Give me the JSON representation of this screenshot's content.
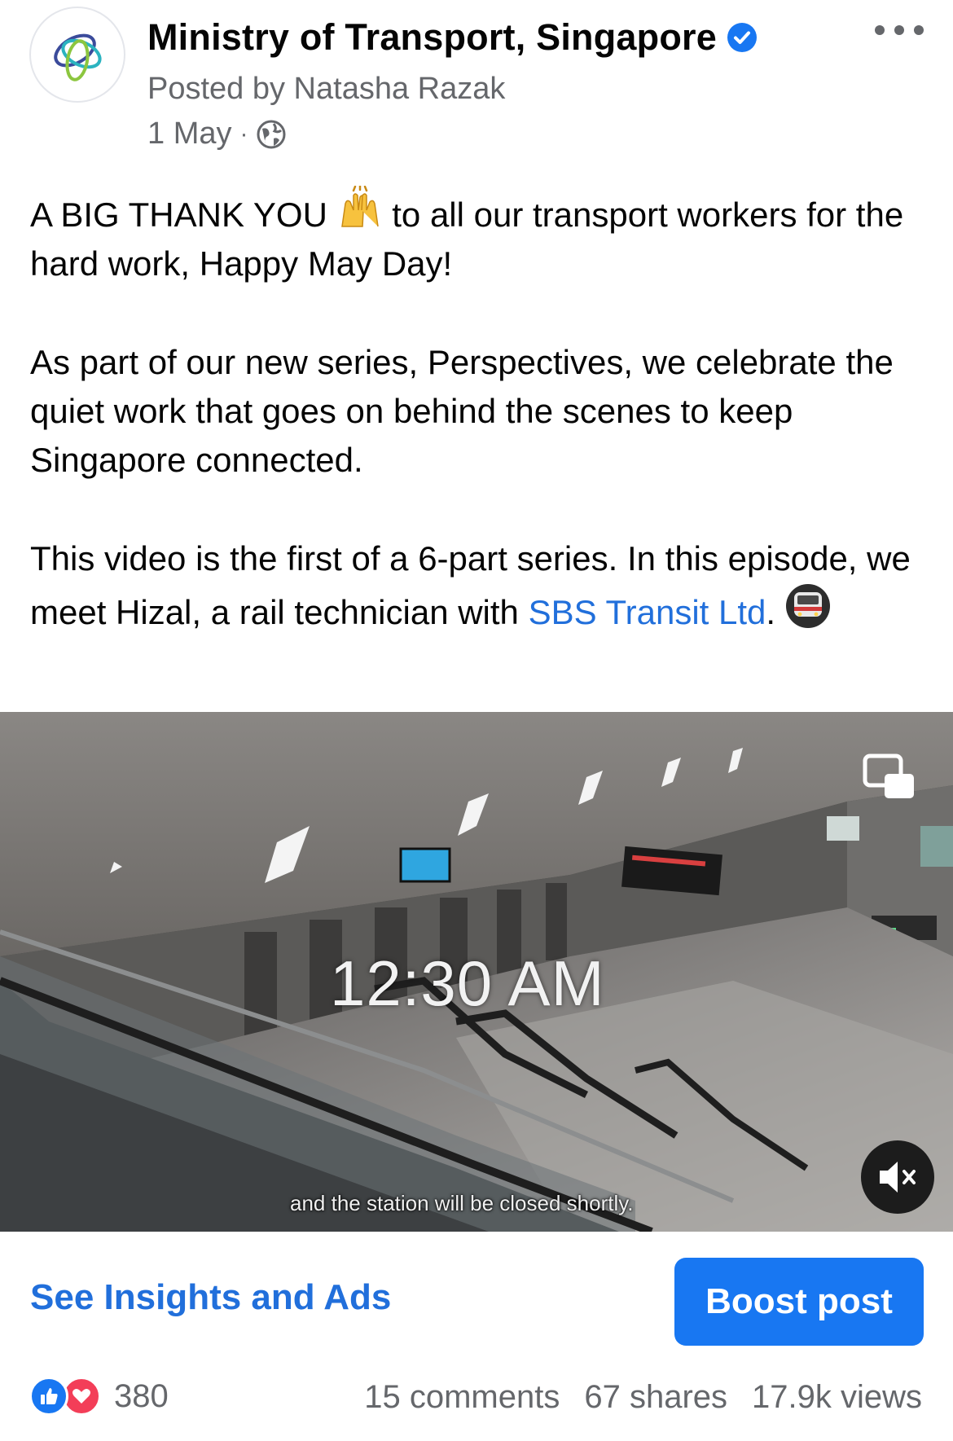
{
  "post": {
    "page_name": "Ministry of Transport, Singapore",
    "posted_by": "Posted by Natasha Razak",
    "date": "1 May",
    "separator": "·",
    "verified_icon": "verified-badge-icon",
    "privacy_icon": "globe-icon",
    "more_icon": "more-options-icon"
  },
  "body": {
    "p1_before_emoji": "A BIG THANK YOU ",
    "p1_emoji": "🙌",
    "p1_after_emoji": " to all our transport workers for the hard work, Happy May Day!",
    "p2": "As part of our new series, Perspectives, we celebrate the quiet work that goes on behind the scenes to keep Singapore connected.",
    "p3_before_link": "This video is the first of a 6-part series. In this episode, we meet Hizal, a rail technician with ",
    "p3_link": "SBS Transit Ltd",
    "p3_after_link": ".",
    "p3_emoji": "🚇"
  },
  "video": {
    "time_overlay": "12:30 AM",
    "subtitle": "and the station will be closed shortly.",
    "pip_icon": "picture-in-picture-icon",
    "mute_icon": "muted-speaker-icon"
  },
  "actions": {
    "insights_label": "See Insights and Ads",
    "boost_label": "Boost post"
  },
  "stats": {
    "reaction_count": "380",
    "reaction_icons": [
      "like-icon",
      "love-icon"
    ],
    "comments": "15 comments",
    "shares": "67 shares",
    "views": "17.9k views"
  },
  "colors": {
    "link_blue": "#216fdb",
    "button_blue": "#1877f2",
    "secondary_text": "#65676b",
    "love_red": "#f33e58"
  }
}
